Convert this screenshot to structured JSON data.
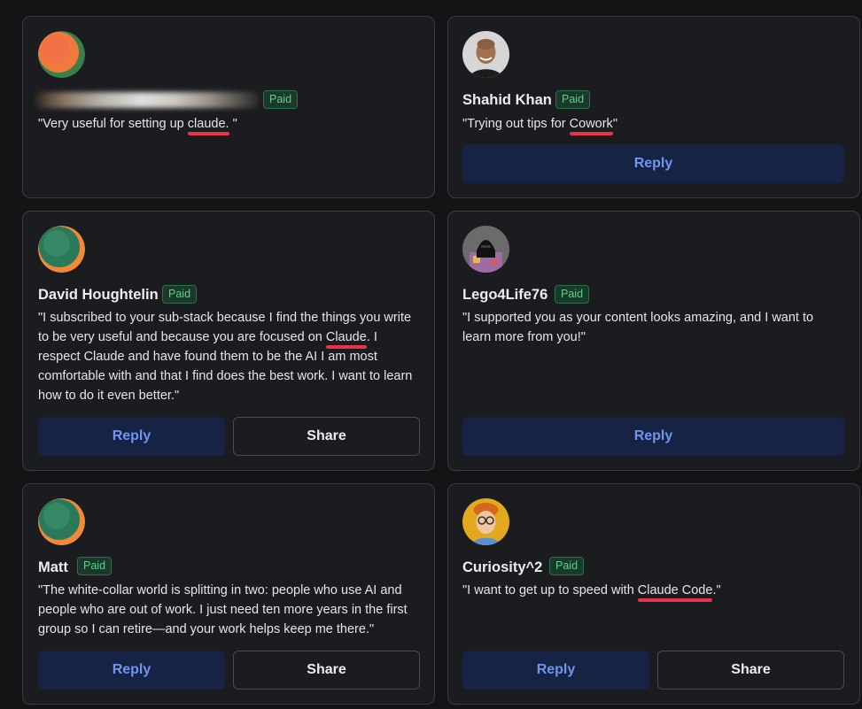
{
  "badge_label": "Paid",
  "buttons": {
    "reply_label": "Reply",
    "share_label": "Share"
  },
  "comments": [
    {
      "name": "",
      "text_before": "\"Very useful for setting up ",
      "highlight": "claude.",
      "text_after": " \""
    },
    {
      "name": "Shahid Khan",
      "text_before": "\"Trying out tips for ",
      "highlight": "Cowork",
      "text_after": "\""
    },
    {
      "name": "David Houghtelin",
      "text_before": "\"I subscribed to your sub-stack because I find the things you write to be very useful and because you are focused on ",
      "highlight": "Claude",
      "text_after": ". I respect Claude and have found them to be the AI I am most comfortable with and that I find does the best work. I want to learn how to do it even better.\""
    },
    {
      "name": "Lego4Life76",
      "text": "\"I supported you as your content looks amazing, and I want to learn more from you!\""
    },
    {
      "name": "Matt",
      "text": "\"The white-collar world is splitting in two: people who use AI and people who are out of work. I just need ten more years in the first group so I can retire—and your work helps keep me there.\""
    },
    {
      "name": "Curiosity^2",
      "text_before": "\"I want to get up to speed with ",
      "highlight": "Claude Code",
      "text_after": ".\""
    }
  ],
  "colors": {
    "background": "#131416",
    "card": "#1b1c1f",
    "paid_badge_text": "#5fd08c",
    "reply_button_bg": "#162344",
    "reply_button_text": "#6f95ee",
    "highlight_underline": "#e8334a"
  }
}
